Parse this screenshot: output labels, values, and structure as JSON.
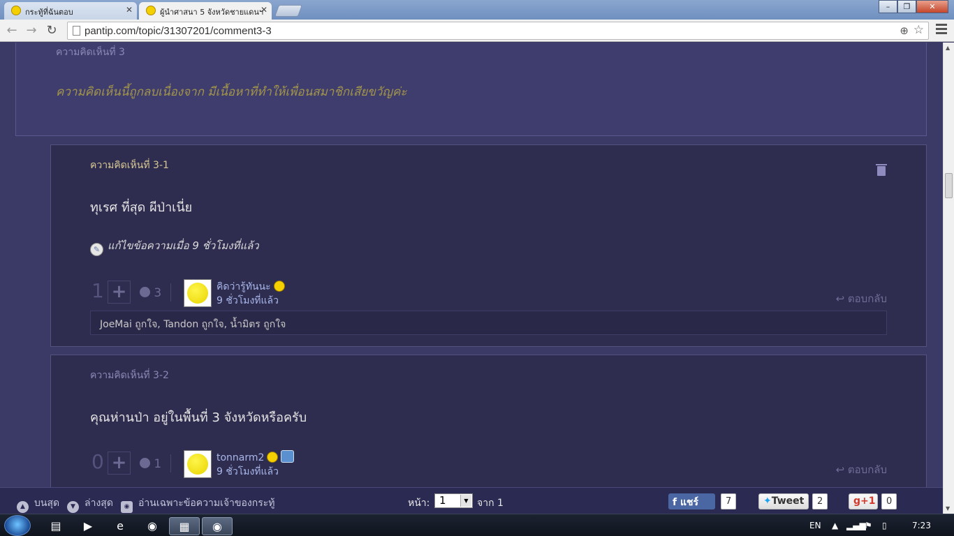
{
  "browser": {
    "tabs": [
      {
        "title": "กระทู้ที่ฉันตอบ",
        "active": false
      },
      {
        "title": "ผู้นำศาสนา 5 จังหวัดชายแดนฯ",
        "active": true
      }
    ],
    "url": "pantip.com/topic/31307201/comment3-3",
    "window_buttons": {
      "minimize": "–",
      "maximize": "❐",
      "close": "✕"
    }
  },
  "main_comment": {
    "number_label": "ความคิดเห็นที่ 3",
    "deleted_message": "ความคิดเห็นนี้ถูกลบเนื่องจาก มีเนื้อหาที่ทำให้เพื่อนสมาชิกเสียขวัญค่ะ"
  },
  "replies": [
    {
      "number_label": "ความคิดเห็นที่ 3-1",
      "body": "ทุเรศ ที่สุด ผีป่าเนี่ย",
      "edited_note": "แก้ไขข้อความเมื่อ 9 ชั่วโมงที่แล้ว",
      "vote_count": "1",
      "emotion_count": "3",
      "author": "คิดว่ารู้ทันนะ",
      "time": "9 ชั่วโมงที่แล้ว",
      "reply_label": "ตอบกลับ",
      "likes": "JoeMai ถูกใจ, Tandon ถูกใจ, น้ำมิตร ถูกใจ"
    },
    {
      "number_label": "ความคิดเห็นที่ 3-2",
      "body": "คุณห่านป่า อยู่ในพื้นที่ 3 จังหวัดหรือครับ",
      "vote_count": "0",
      "emotion_count": "1",
      "author": "tonnarm2",
      "time": "9 ชั่วโมงที่แล้ว",
      "reply_label": "ตอบกลับ"
    }
  ],
  "bottom_bar": {
    "top_label": "บนสุด",
    "bottom_label": "ล่างสุด",
    "owner_only_label": "อ่านเฉพาะข้อความเจ้าของกระทู้",
    "page_label": "หน้า:",
    "page_value": "1",
    "of_label": "จาก 1",
    "fb_label": "แชร์",
    "fb_count": "7",
    "tweet_label": "Tweet",
    "tweet_count": "2",
    "gplus_label": "+1",
    "gplus_count": "0"
  },
  "taskbar": {
    "language": "EN",
    "clock": "7:23"
  },
  "colors": {
    "page_bg": "#3b3a66",
    "comment_bg": "#2e2c4f",
    "deleted_text": "#a3954a",
    "username": "#a8b7ea"
  }
}
